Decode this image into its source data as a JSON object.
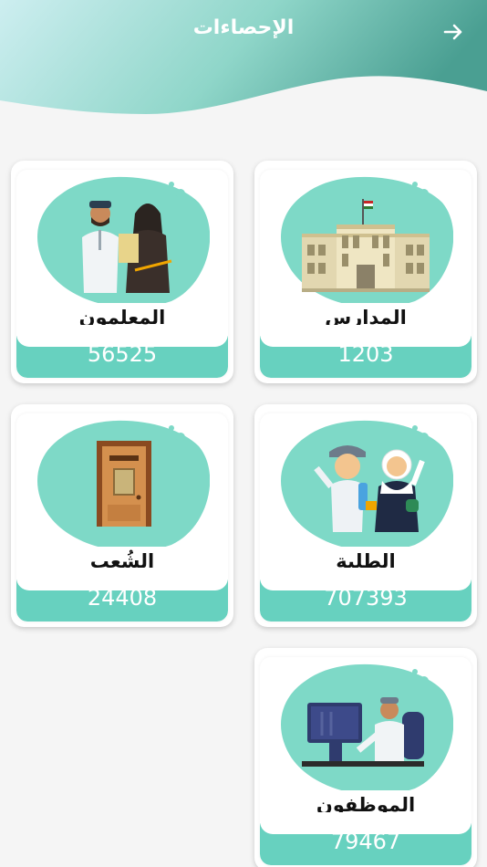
{
  "header": {
    "title": "الإحصاءات"
  },
  "colors": {
    "accent": "#67d1bf",
    "header_start": "#c7ece6",
    "header_end": "#4ea698"
  },
  "cards": [
    {
      "label": "المدارس",
      "count": "1203",
      "icon": "school-building-icon"
    },
    {
      "label": "المعلمون",
      "count": "56525",
      "icon": "teachers-icon"
    },
    {
      "label": "الطلبة",
      "count": "707393",
      "icon": "students-icon"
    },
    {
      "label": "الشُعب",
      "count": "24408",
      "icon": "classroom-door-icon"
    },
    {
      "label": "الموظفون",
      "count": "79467",
      "icon": "employee-computer-icon"
    }
  ]
}
